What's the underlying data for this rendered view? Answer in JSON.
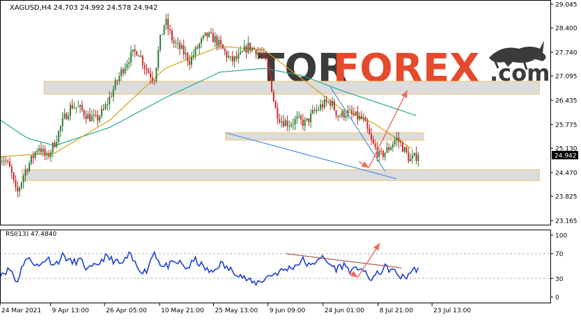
{
  "header": {
    "symbol_line": "XAGUSD,H4  24.703 24.992 24.578 24.942",
    "symbol": "XAGUSD,H4",
    "ohlc": [
      24.703,
      24.992,
      24.578,
      24.942
    ]
  },
  "watermark": {
    "brand_left": "TOR",
    "brand_right": "FOREX",
    "brand_suffix": ".com"
  },
  "colors": {
    "background": "#ffffff",
    "bull_candle": "#2e7d32",
    "bear_candle": "#c62828",
    "ma_fast": "#d4a017",
    "ma_slow": "#26a69a",
    "trendline": "#4a90e2",
    "arrow": "#f06a5a",
    "zone_fill": "#dcdcdc",
    "zone_border": "#f2c36b",
    "rsi_line": "#1a3fd6",
    "rsi_trend": "#a0524a",
    "axis_text": "#000000",
    "brand_dark": "#2b2b2b",
    "brand_red": "#e23b1a"
  },
  "chart_data": [
    {
      "type": "candlestick",
      "title": "XAGUSD,H4",
      "last_price": 24.942,
      "ylim": [
        23.165,
        29.045
      ],
      "y_ticks": [
        "29.045",
        "28.400",
        "27.740",
        "27.095",
        "26.435",
        "25.775",
        "25.130",
        "24.942",
        "24.470",
        "23.825",
        "23.165"
      ],
      "x_ticks": [
        "24 Mar 2021",
        "9 Apr 13:00",
        "26 Apr 05:00",
        "10 May 21:00",
        "25 May 13:00",
        "9 Jun 09:00",
        "24 Jun 01:00",
        "8 Jul 21:00",
        "23 Jul 13:00"
      ],
      "x_tick_values": [
        0,
        0.092,
        0.19,
        0.29,
        0.388,
        0.487,
        0.587,
        0.687,
        0.785
      ],
      "close_path": [
        [
          0,
          24.9
        ],
        [
          0.01,
          24.8
        ],
        [
          0.02,
          24.5
        ],
        [
          0.03,
          23.85
        ],
        [
          0.045,
          24.5
        ],
        [
          0.06,
          24.9
        ],
        [
          0.07,
          25.2
        ],
        [
          0.085,
          24.85
        ],
        [
          0.1,
          25.3
        ],
        [
          0.115,
          25.9
        ],
        [
          0.13,
          26.3
        ],
        [
          0.145,
          26.2
        ],
        [
          0.16,
          26.0
        ],
        [
          0.175,
          25.9
        ],
        [
          0.19,
          26.2
        ],
        [
          0.205,
          26.7
        ],
        [
          0.22,
          27.2
        ],
        [
          0.235,
          27.6
        ],
        [
          0.25,
          27.8
        ],
        [
          0.265,
          27.3
        ],
        [
          0.28,
          27.0
        ],
        [
          0.29,
          28.0
        ],
        [
          0.3,
          28.6
        ],
        [
          0.315,
          28.0
        ],
        [
          0.33,
          27.8
        ],
        [
          0.345,
          27.5
        ],
        [
          0.36,
          27.9
        ],
        [
          0.375,
          28.2
        ],
        [
          0.39,
          28.1
        ],
        [
          0.405,
          27.8
        ],
        [
          0.42,
          27.5
        ],
        [
          0.435,
          27.6
        ],
        [
          0.45,
          27.9
        ],
        [
          0.465,
          27.8
        ],
        [
          0.48,
          27.6
        ],
        [
          0.49,
          27.1
        ],
        [
          0.5,
          26.2
        ],
        [
          0.51,
          25.9
        ],
        [
          0.525,
          25.8
        ],
        [
          0.54,
          25.9
        ],
        [
          0.555,
          25.8
        ],
        [
          0.57,
          26.1
        ],
        [
          0.585,
          26.3
        ],
        [
          0.6,
          26.4
        ],
        [
          0.615,
          26.0
        ],
        [
          0.63,
          26.1
        ],
        [
          0.645,
          26.0
        ],
        [
          0.66,
          25.9
        ],
        [
          0.675,
          25.3
        ],
        [
          0.69,
          24.9
        ],
        [
          0.705,
          25.1
        ],
        [
          0.72,
          25.4
        ],
        [
          0.73,
          25.2
        ],
        [
          0.745,
          24.8
        ],
        [
          0.76,
          24.942
        ]
      ],
      "candle_count": 215,
      "ma_fast_path": [
        [
          0,
          24.9
        ],
        [
          0.1,
          25.0
        ],
        [
          0.2,
          25.9
        ],
        [
          0.3,
          27.3
        ],
        [
          0.4,
          27.9
        ],
        [
          0.48,
          27.8
        ],
        [
          0.55,
          27.0
        ],
        [
          0.62,
          26.2
        ],
        [
          0.68,
          25.8
        ],
        [
          0.75,
          25.1
        ]
      ],
      "ma_slow_path": [
        [
          0,
          25.9
        ],
        [
          0.05,
          25.4
        ],
        [
          0.1,
          25.2
        ],
        [
          0.2,
          25.7
        ],
        [
          0.3,
          26.5
        ],
        [
          0.4,
          27.2
        ],
        [
          0.48,
          27.3
        ],
        [
          0.55,
          27.1
        ],
        [
          0.62,
          26.7
        ],
        [
          0.7,
          26.3
        ],
        [
          0.76,
          26.0
        ]
      ],
      "zones": [
        {
          "x": [
            0.08,
            0.98
          ],
          "y": [
            26.6,
            26.95
          ]
        },
        {
          "x": [
            0.41,
            0.77
          ],
          "y": [
            25.35,
            25.55
          ]
        },
        {
          "x": [
            0.04,
            0.98
          ],
          "y": [
            24.25,
            24.55
          ]
        }
      ],
      "trendlines": [
        {
          "from": [
            0.41,
            25.55
          ],
          "to": [
            0.72,
            24.3
          ]
        },
        {
          "from": [
            0.6,
            26.8
          ],
          "to": [
            0.7,
            24.5
          ]
        }
      ],
      "arrows": [
        {
          "from": [
            0.67,
            24.6
          ],
          "to": [
            0.74,
            26.7
          ]
        }
      ]
    },
    {
      "type": "line",
      "title": "RSI(13) 47.4840",
      "label": "RSI(13)",
      "value": 47.484,
      "ylim": [
        0,
        100
      ],
      "y_ticks": [
        "100",
        "70",
        "30",
        "0"
      ],
      "levels": [
        70,
        30
      ],
      "path": [
        [
          0,
          38
        ],
        [
          0.02,
          45
        ],
        [
          0.03,
          22
        ],
        [
          0.045,
          62
        ],
        [
          0.06,
          58
        ],
        [
          0.07,
          48
        ],
        [
          0.085,
          64
        ],
        [
          0.1,
          52
        ],
        [
          0.115,
          68
        ],
        [
          0.13,
          55
        ],
        [
          0.145,
          60
        ],
        [
          0.16,
          44
        ],
        [
          0.175,
          50
        ],
        [
          0.19,
          65
        ],
        [
          0.205,
          60
        ],
        [
          0.22,
          52
        ],
        [
          0.235,
          68
        ],
        [
          0.25,
          48
        ],
        [
          0.265,
          40
        ],
        [
          0.28,
          74
        ],
        [
          0.295,
          48
        ],
        [
          0.31,
          52
        ],
        [
          0.325,
          56
        ],
        [
          0.34,
          46
        ],
        [
          0.355,
          60
        ],
        [
          0.37,
          48
        ],
        [
          0.385,
          38
        ],
        [
          0.4,
          55
        ],
        [
          0.415,
          45
        ],
        [
          0.43,
          40
        ],
        [
          0.445,
          30
        ],
        [
          0.46,
          22
        ],
        [
          0.475,
          26
        ],
        [
          0.49,
          35
        ],
        [
          0.505,
          40
        ],
        [
          0.52,
          45
        ],
        [
          0.535,
          50
        ],
        [
          0.55,
          60
        ],
        [
          0.565,
          48
        ],
        [
          0.58,
          66
        ],
        [
          0.595,
          56
        ],
        [
          0.61,
          46
        ],
        [
          0.625,
          52
        ],
        [
          0.64,
          40
        ],
        [
          0.655,
          50
        ],
        [
          0.67,
          28
        ],
        [
          0.685,
          36
        ],
        [
          0.7,
          48
        ],
        [
          0.715,
          42
        ],
        [
          0.725,
          35
        ],
        [
          0.735,
          30
        ],
        [
          0.745,
          40
        ],
        [
          0.76,
          47.48
        ]
      ],
      "trendline": {
        "from": [
          0.52,
          70
        ],
        "to": [
          0.73,
          47
        ]
      },
      "arrows": [
        {
          "from": [
            0.65,
            32
          ],
          "to": [
            0.69,
            87
          ]
        }
      ]
    }
  ]
}
